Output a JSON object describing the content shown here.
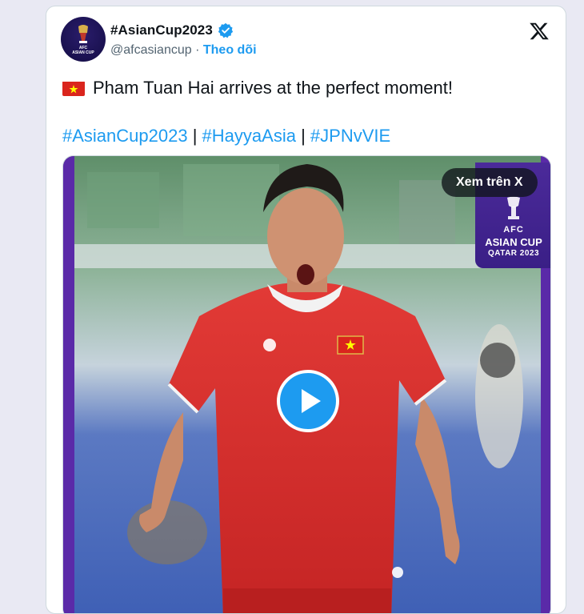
{
  "tweet": {
    "author_name": "#AsianCup2023",
    "handle": "@afcasiancup",
    "separator": "·",
    "follow_label": "Theo dõi",
    "text": "Pham Tuan Hai arrives at the perfect moment!",
    "hashtags": [
      "#AsianCup2023",
      "#HayyaAsia",
      "#JPNvVIE"
    ],
    "hashtag_separator": "|"
  },
  "media": {
    "watch_on_x_label": "Xem trên X",
    "logo": {
      "line1": "AFC",
      "line2": "ASIAN CUP",
      "line3": "QATAR 2023"
    }
  },
  "icons": {
    "verified": "verified-badge-icon",
    "x_logo": "x-logo-icon",
    "flag": "vietnam-flag-icon",
    "play": "play-icon"
  },
  "colors": {
    "accent": "#1d9bf0",
    "text": "#0f1419",
    "muted": "#536471",
    "jersey": "#d42a2a",
    "logo_purple": "#3a1f86"
  }
}
